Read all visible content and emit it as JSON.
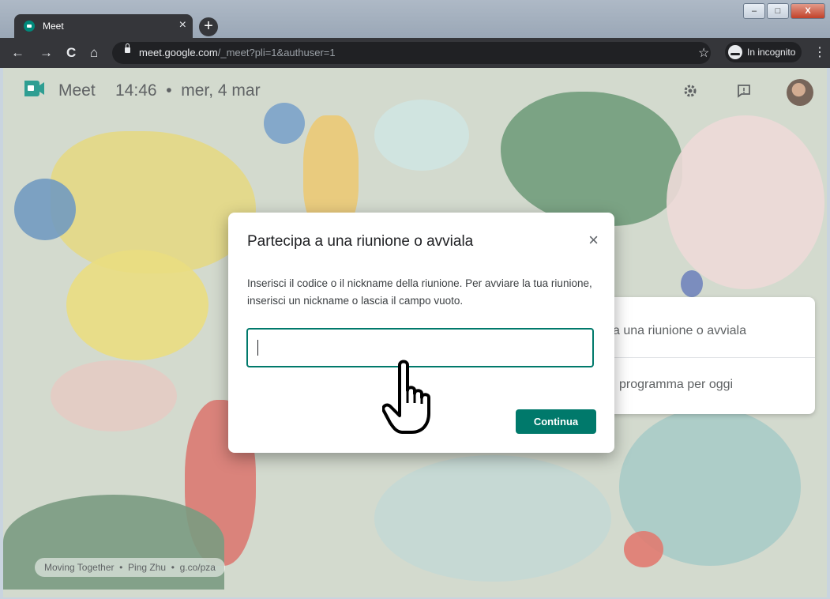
{
  "browser": {
    "tab_title": "Meet",
    "tab_close": "×",
    "new_tab": "+",
    "url_host": "meet.google.com",
    "url_path": "/_meet?pli=1&authuser=1",
    "incognito_label": "In incognito",
    "nav": {
      "back": "←",
      "forward": "→",
      "reload": "C",
      "home": "⌂"
    },
    "star": "☆",
    "menu": "⋮",
    "window_buttons": {
      "minimize": "‒",
      "maximize": "□",
      "close": "X"
    }
  },
  "meet": {
    "title": "Meet",
    "datetime": "14:46  •  mer, 4 mar",
    "header_icons": [
      "gear-icon",
      "feedback-icon"
    ],
    "side_card": {
      "row1": "a una riunione o avviala",
      "row2": "programma per oggi"
    },
    "credit": "Moving Together  •  Ping Zhu  •  g.co/pza"
  },
  "dialog": {
    "title": "Partecipa a una riunione o avviala",
    "close": "×",
    "text": "Inserisci il codice o il nickname della riunione. Per avviare la tua riunione, inserisci un nickname o lascia il campo vuoto.",
    "input_value": "",
    "button": "Continua"
  },
  "colors": {
    "accent": "#00796b",
    "chrome_dark": "#35363a"
  }
}
